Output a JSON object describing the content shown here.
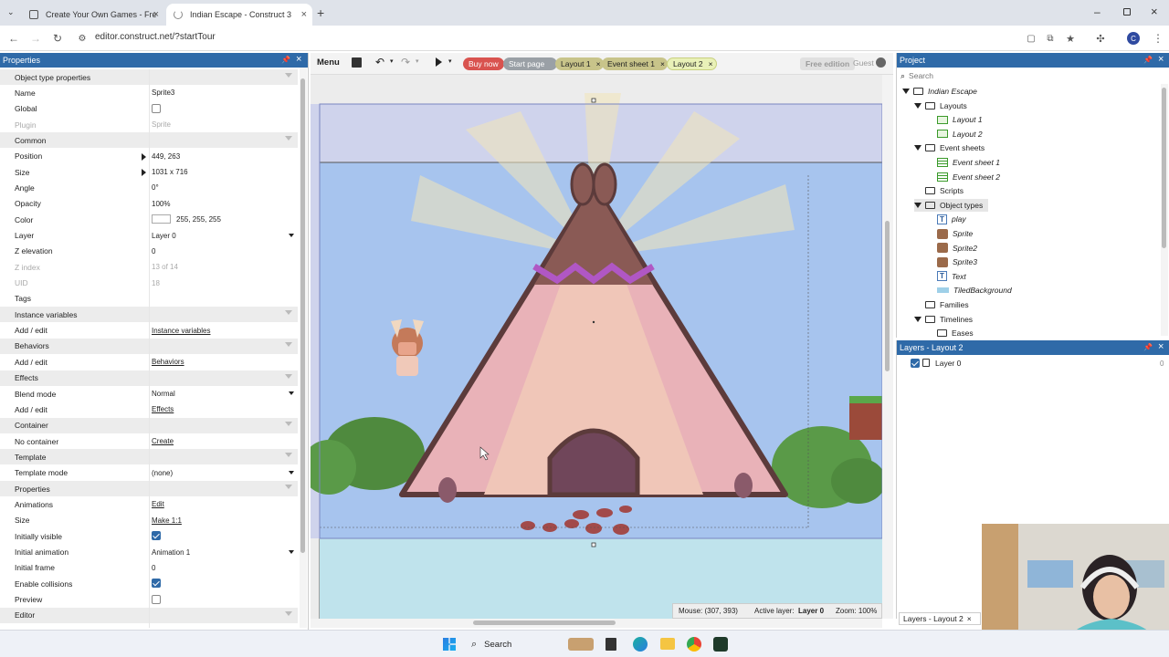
{
  "browser": {
    "tabs": [
      {
        "label": "Create Your Own Games - Free",
        "active": false
      },
      {
        "label": "Indian Escape - Construct 3",
        "active": true
      }
    ],
    "url": "editor.construct.net/?startTour",
    "profile_initial": "C"
  },
  "construct": {
    "menu_label": "Menu",
    "tabs": [
      "Buy now",
      "Start page",
      "Layout 1",
      "Event sheet 1",
      "Layout 2"
    ],
    "free_edition": "Free edition",
    "guest": "Guest",
    "status": {
      "mouse": "Mouse: (307, 393)",
      "active_layer_label": "Active layer:",
      "active_layer_value": "Layer 0",
      "zoom": "Zoom: 100%"
    }
  },
  "properties": {
    "title": "Properties",
    "rows": [
      {
        "type": "section",
        "label": "Object type properties"
      },
      {
        "type": "text",
        "label": "Name",
        "value": "Sprite3"
      },
      {
        "type": "check",
        "label": "Global",
        "checked": false
      },
      {
        "type": "text",
        "label": "Plugin",
        "value": "Sprite",
        "disabled": true
      },
      {
        "type": "section",
        "label": "Common"
      },
      {
        "type": "expand",
        "label": "Position",
        "value": "449, 263"
      },
      {
        "type": "expand",
        "label": "Size",
        "value": "1031 x 716"
      },
      {
        "type": "text",
        "label": "Angle",
        "value": "0°"
      },
      {
        "type": "text",
        "label": "Opacity",
        "value": "100%"
      },
      {
        "type": "color",
        "label": "Color",
        "value": "255, 255, 255"
      },
      {
        "type": "dropdown",
        "label": "Layer",
        "value": "Layer 0"
      },
      {
        "type": "text",
        "label": "Z elevation",
        "value": "0"
      },
      {
        "type": "text",
        "label": "Z index",
        "value": "13 of 14",
        "disabled": true
      },
      {
        "type": "text",
        "label": "UID",
        "value": "18",
        "disabled": true
      },
      {
        "type": "text",
        "label": "Tags",
        "value": ""
      },
      {
        "type": "section",
        "label": "Instance variables"
      },
      {
        "type": "link",
        "label": "Add / edit",
        "value": "Instance variables"
      },
      {
        "type": "section",
        "label": "Behaviors"
      },
      {
        "type": "link",
        "label": "Add / edit",
        "value": "Behaviors"
      },
      {
        "type": "section",
        "label": "Effects"
      },
      {
        "type": "dropdown",
        "label": "Blend mode",
        "value": "Normal"
      },
      {
        "type": "link",
        "label": "Add / edit",
        "value": "Effects"
      },
      {
        "type": "section",
        "label": "Container"
      },
      {
        "type": "link",
        "label": "No container",
        "value": "Create"
      },
      {
        "type": "section",
        "label": "Template"
      },
      {
        "type": "dropdown",
        "label": "Template mode",
        "value": "(none)"
      },
      {
        "type": "section",
        "label": "Properties"
      },
      {
        "type": "link",
        "label": "Animations",
        "value": "Edit"
      },
      {
        "type": "link",
        "label": "Size",
        "value": "Make 1:1"
      },
      {
        "type": "check",
        "label": "Initially visible",
        "checked": true
      },
      {
        "type": "dropdown",
        "label": "Initial animation",
        "value": "Animation 1"
      },
      {
        "type": "text",
        "label": "Initial frame",
        "value": "0"
      },
      {
        "type": "check",
        "label": "Enable collisions",
        "checked": true
      },
      {
        "type": "check",
        "label": "Preview",
        "checked": false
      },
      {
        "type": "section",
        "label": "Editor"
      }
    ]
  },
  "project": {
    "title": "Project",
    "search_placeholder": "Search",
    "tree": [
      {
        "label": "Indian Escape",
        "kind": "folder",
        "depth": 0,
        "arrow": true,
        "italic": true
      },
      {
        "label": "Layouts",
        "kind": "folder",
        "depth": 1,
        "arrow": true
      },
      {
        "label": "Layout 1",
        "kind": "layout",
        "depth": 2,
        "italic": true
      },
      {
        "label": "Layout 2",
        "kind": "layout",
        "depth": 2,
        "italic": true
      },
      {
        "label": "Event sheets",
        "kind": "folder",
        "depth": 1,
        "arrow": true
      },
      {
        "label": "Event sheet 1",
        "kind": "event",
        "depth": 2,
        "italic": true
      },
      {
        "label": "Event sheet 2",
        "kind": "event",
        "depth": 2,
        "italic": true
      },
      {
        "label": "Scripts",
        "kind": "folder",
        "depth": 1
      },
      {
        "label": "Object types",
        "kind": "folder",
        "depth": 1,
        "arrow": true,
        "selected": true
      },
      {
        "label": "play",
        "kind": "text-obj",
        "depth": 2,
        "italic": true
      },
      {
        "label": "Sprite",
        "kind": "sprite-obj",
        "depth": 2,
        "italic": true
      },
      {
        "label": "Sprite2",
        "kind": "sprite-obj",
        "depth": 2,
        "italic": true
      },
      {
        "label": "Sprite3",
        "kind": "sprite-obj",
        "depth": 2,
        "italic": true
      },
      {
        "label": "Text",
        "kind": "text-obj",
        "depth": 2,
        "italic": true
      },
      {
        "label": "TiledBackground",
        "kind": "tiled-obj",
        "depth": 2,
        "italic": true
      },
      {
        "label": "Families",
        "kind": "folder",
        "depth": 1
      },
      {
        "label": "Timelines",
        "kind": "folder",
        "depth": 1,
        "arrow": true
      },
      {
        "label": "Eases",
        "kind": "folder",
        "depth": 2
      }
    ]
  },
  "layers": {
    "title": "Layers - Layout 2",
    "items": [
      {
        "label": "Layer 0",
        "count": "0"
      }
    ],
    "bottom_tab": "Layers - Layout 2"
  },
  "taskbar": {
    "search_label": "Search"
  }
}
